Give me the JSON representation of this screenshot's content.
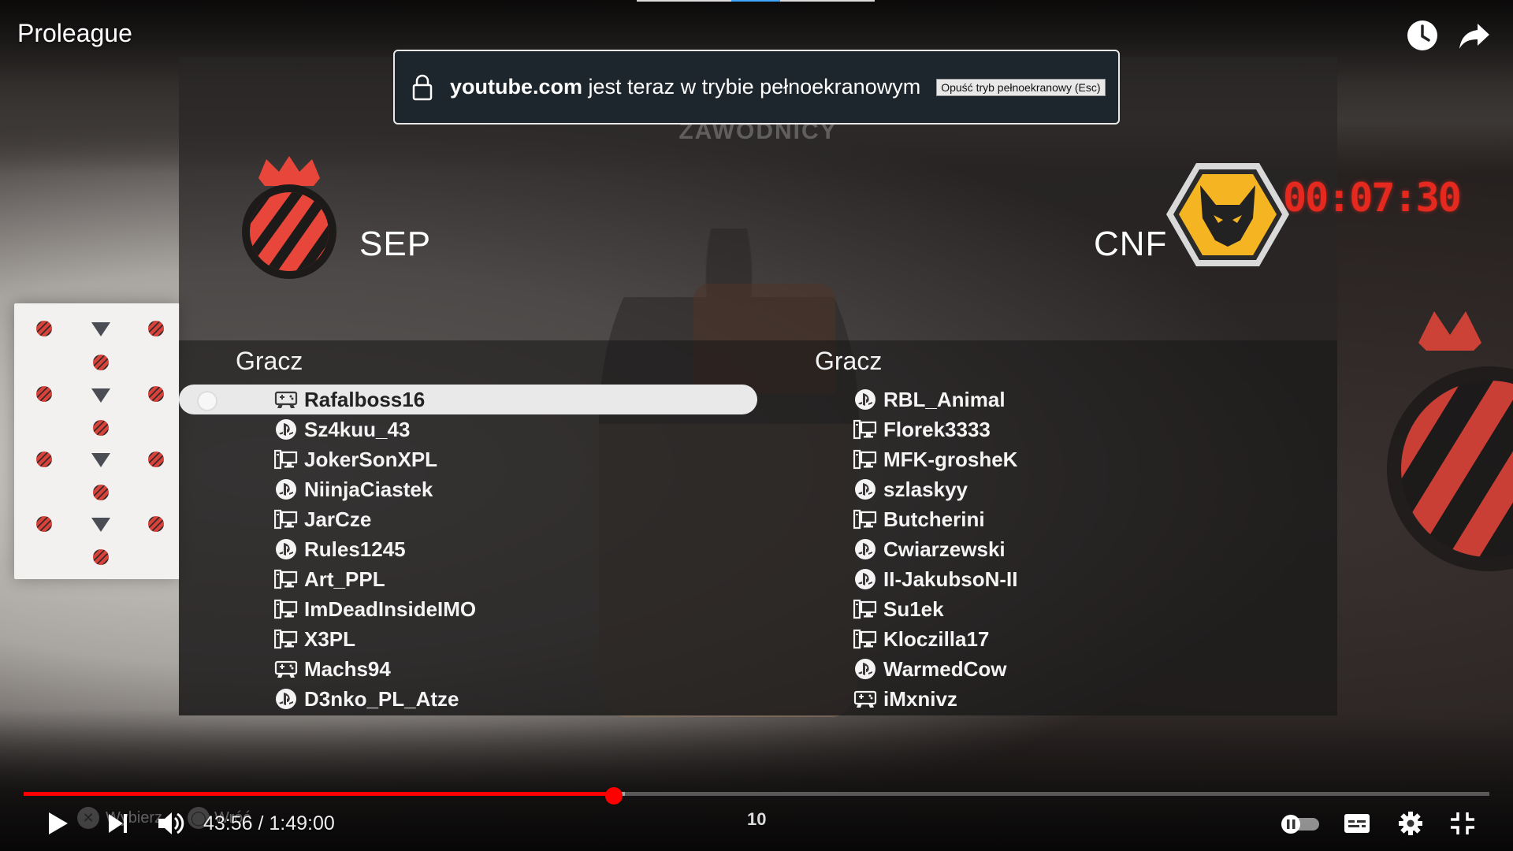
{
  "video": {
    "title": "Proleague",
    "watch_later_icon": "clock-icon",
    "share_icon": "share-icon"
  },
  "fullscreen_notice": {
    "domain": "youtube.com",
    "message": "jest teraz w trybie pełnoekranowym",
    "exit_button": "Opuść tryb pełnoekranowy (Esc)",
    "icon": "lock-icon"
  },
  "lineup": {
    "heading": "ZAWODNICY",
    "match_clock": "00:07:30",
    "home": {
      "name": "SEP",
      "column_header": "Gracz",
      "crest_colors": {
        "stripe": "#e8463a",
        "dark": "#1d1a1a",
        "crown": "#e8463a"
      },
      "players": [
        {
          "name": "Rafalboss16",
          "platform": "controller",
          "selected": true
        },
        {
          "name": "Sz4kuu_43",
          "platform": "playstation"
        },
        {
          "name": "JokerSonXPL",
          "platform": "pc"
        },
        {
          "name": "NiinjaCiastek",
          "platform": "playstation"
        },
        {
          "name": "JarCze",
          "platform": "pc"
        },
        {
          "name": "Rules1245",
          "platform": "playstation"
        },
        {
          "name": "Art_PPL",
          "platform": "pc"
        },
        {
          "name": "ImDeadInsideIMO",
          "platform": "pc"
        },
        {
          "name": "X3PL",
          "platform": "pc"
        },
        {
          "name": "Machs94",
          "platform": "controller"
        },
        {
          "name": "D3nko_PL_Atze",
          "platform": "playstation"
        }
      ]
    },
    "away": {
      "name": "CNF",
      "column_header": "Gracz",
      "crest_colors": {
        "gold": "#f5b422",
        "dark": "#222",
        "border": "#d9d9d9"
      },
      "players": [
        {
          "name": "RBL_Animal",
          "platform": "playstation"
        },
        {
          "name": "Florek3333",
          "platform": "pc"
        },
        {
          "name": "MFK-grosheK",
          "platform": "pc"
        },
        {
          "name": "szlaskyy",
          "platform": "playstation"
        },
        {
          "name": "Butcherini",
          "platform": "pc"
        },
        {
          "name": "Cwiarzewski",
          "platform": "playstation"
        },
        {
          "name": "II-JakubsoN-II",
          "platform": "playstation"
        },
        {
          "name": "Su1ek",
          "platform": "pc"
        },
        {
          "name": "Kloczilla17",
          "platform": "pc"
        },
        {
          "name": "WarmedCow",
          "platform": "playstation"
        },
        {
          "name": "iMxnivz",
          "platform": "controller"
        }
      ]
    }
  },
  "player_controls": {
    "current_time": "43:56",
    "duration": "1:49:00",
    "time_display": "43:56 / 1:49:00",
    "progress_fraction": 0.4028,
    "buffered_fraction": 0.41,
    "seek_badge": "10",
    "ghost_button_1": "Wybierz",
    "ghost_button_2": "Wróć",
    "accent_color": "#ff0000",
    "icons": [
      "play-icon",
      "next-icon",
      "volume-icon",
      "autoplay-toggle",
      "subtitles-icon",
      "settings-icon",
      "exit-fullscreen-icon"
    ]
  }
}
